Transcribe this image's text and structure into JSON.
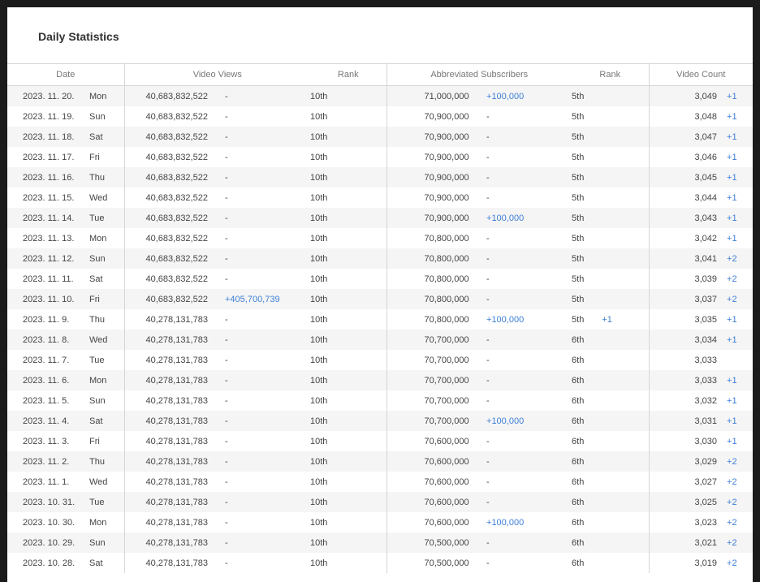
{
  "page": {
    "title": "Daily Statistics"
  },
  "columns": {
    "date": "Date",
    "video_views": "Video Views",
    "rank": "Rank",
    "subscribers": "Abbreviated Subscribers",
    "sub_rank": "Rank",
    "video_count": "Video Count"
  },
  "accent_color": "#3d7fd6",
  "rows": [
    {
      "date": "2023. 11. 20.",
      "day": "Mon",
      "views": "40,683,832,522",
      "views_change": "-",
      "rank": "10th",
      "subs": "71,000,000",
      "subs_change": "+100,000",
      "sub_rank": "5th",
      "sub_rank_change": "",
      "video_count": "3,049",
      "video_count_change": "+1"
    },
    {
      "date": "2023. 11. 19.",
      "day": "Sun",
      "views": "40,683,832,522",
      "views_change": "-",
      "rank": "10th",
      "subs": "70,900,000",
      "subs_change": "-",
      "sub_rank": "5th",
      "sub_rank_change": "",
      "video_count": "3,048",
      "video_count_change": "+1"
    },
    {
      "date": "2023. 11. 18.",
      "day": "Sat",
      "views": "40,683,832,522",
      "views_change": "-",
      "rank": "10th",
      "subs": "70,900,000",
      "subs_change": "-",
      "sub_rank": "5th",
      "sub_rank_change": "",
      "video_count": "3,047",
      "video_count_change": "+1"
    },
    {
      "date": "2023. 11. 17.",
      "day": "Fri",
      "views": "40,683,832,522",
      "views_change": "-",
      "rank": "10th",
      "subs": "70,900,000",
      "subs_change": "-",
      "sub_rank": "5th",
      "sub_rank_change": "",
      "video_count": "3,046",
      "video_count_change": "+1"
    },
    {
      "date": "2023. 11. 16.",
      "day": "Thu",
      "views": "40,683,832,522",
      "views_change": "-",
      "rank": "10th",
      "subs": "70,900,000",
      "subs_change": "-",
      "sub_rank": "5th",
      "sub_rank_change": "",
      "video_count": "3,045",
      "video_count_change": "+1"
    },
    {
      "date": "2023. 11. 15.",
      "day": "Wed",
      "views": "40,683,832,522",
      "views_change": "-",
      "rank": "10th",
      "subs": "70,900,000",
      "subs_change": "-",
      "sub_rank": "5th",
      "sub_rank_change": "",
      "video_count": "3,044",
      "video_count_change": "+1"
    },
    {
      "date": "2023. 11. 14.",
      "day": "Tue",
      "views": "40,683,832,522",
      "views_change": "-",
      "rank": "10th",
      "subs": "70,900,000",
      "subs_change": "+100,000",
      "sub_rank": "5th",
      "sub_rank_change": "",
      "video_count": "3,043",
      "video_count_change": "+1"
    },
    {
      "date": "2023. 11. 13.",
      "day": "Mon",
      "views": "40,683,832,522",
      "views_change": "-",
      "rank": "10th",
      "subs": "70,800,000",
      "subs_change": "-",
      "sub_rank": "5th",
      "sub_rank_change": "",
      "video_count": "3,042",
      "video_count_change": "+1"
    },
    {
      "date": "2023. 11. 12.",
      "day": "Sun",
      "views": "40,683,832,522",
      "views_change": "-",
      "rank": "10th",
      "subs": "70,800,000",
      "subs_change": "-",
      "sub_rank": "5th",
      "sub_rank_change": "",
      "video_count": "3,041",
      "video_count_change": "+2"
    },
    {
      "date": "2023. 11. 11.",
      "day": "Sat",
      "views": "40,683,832,522",
      "views_change": "-",
      "rank": "10th",
      "subs": "70,800,000",
      "subs_change": "-",
      "sub_rank": "5th",
      "sub_rank_change": "",
      "video_count": "3,039",
      "video_count_change": "+2"
    },
    {
      "date": "2023. 11. 10.",
      "day": "Fri",
      "views": "40,683,832,522",
      "views_change": "+405,700,739",
      "rank": "10th",
      "subs": "70,800,000",
      "subs_change": "-",
      "sub_rank": "5th",
      "sub_rank_change": "",
      "video_count": "3,037",
      "video_count_change": "+2"
    },
    {
      "date": "2023. 11. 9.",
      "day": "Thu",
      "views": "40,278,131,783",
      "views_change": "-",
      "rank": "10th",
      "subs": "70,800,000",
      "subs_change": "+100,000",
      "sub_rank": "5th",
      "sub_rank_change": "+1",
      "video_count": "3,035",
      "video_count_change": "+1"
    },
    {
      "date": "2023. 11. 8.",
      "day": "Wed",
      "views": "40,278,131,783",
      "views_change": "-",
      "rank": "10th",
      "subs": "70,700,000",
      "subs_change": "-",
      "sub_rank": "6th",
      "sub_rank_change": "",
      "video_count": "3,034",
      "video_count_change": "+1"
    },
    {
      "date": "2023. 11. 7.",
      "day": "Tue",
      "views": "40,278,131,783",
      "views_change": "-",
      "rank": "10th",
      "subs": "70,700,000",
      "subs_change": "-",
      "sub_rank": "6th",
      "sub_rank_change": "",
      "video_count": "3,033",
      "video_count_change": ""
    },
    {
      "date": "2023. 11. 6.",
      "day": "Mon",
      "views": "40,278,131,783",
      "views_change": "-",
      "rank": "10th",
      "subs": "70,700,000",
      "subs_change": "-",
      "sub_rank": "6th",
      "sub_rank_change": "",
      "video_count": "3,033",
      "video_count_change": "+1"
    },
    {
      "date": "2023. 11. 5.",
      "day": "Sun",
      "views": "40,278,131,783",
      "views_change": "-",
      "rank": "10th",
      "subs": "70,700,000",
      "subs_change": "-",
      "sub_rank": "6th",
      "sub_rank_change": "",
      "video_count": "3,032",
      "video_count_change": "+1"
    },
    {
      "date": "2023. 11. 4.",
      "day": "Sat",
      "views": "40,278,131,783",
      "views_change": "-",
      "rank": "10th",
      "subs": "70,700,000",
      "subs_change": "+100,000",
      "sub_rank": "6th",
      "sub_rank_change": "",
      "video_count": "3,031",
      "video_count_change": "+1"
    },
    {
      "date": "2023. 11. 3.",
      "day": "Fri",
      "views": "40,278,131,783",
      "views_change": "-",
      "rank": "10th",
      "subs": "70,600,000",
      "subs_change": "-",
      "sub_rank": "6th",
      "sub_rank_change": "",
      "video_count": "3,030",
      "video_count_change": "+1"
    },
    {
      "date": "2023. 11. 2.",
      "day": "Thu",
      "views": "40,278,131,783",
      "views_change": "-",
      "rank": "10th",
      "subs": "70,600,000",
      "subs_change": "-",
      "sub_rank": "6th",
      "sub_rank_change": "",
      "video_count": "3,029",
      "video_count_change": "+2"
    },
    {
      "date": "2023. 11. 1.",
      "day": "Wed",
      "views": "40,278,131,783",
      "views_change": "-",
      "rank": "10th",
      "subs": "70,600,000",
      "subs_change": "-",
      "sub_rank": "6th",
      "sub_rank_change": "",
      "video_count": "3,027",
      "video_count_change": "+2"
    },
    {
      "date": "2023. 10. 31.",
      "day": "Tue",
      "views": "40,278,131,783",
      "views_change": "-",
      "rank": "10th",
      "subs": "70,600,000",
      "subs_change": "-",
      "sub_rank": "6th",
      "sub_rank_change": "",
      "video_count": "3,025",
      "video_count_change": "+2"
    },
    {
      "date": "2023. 10. 30.",
      "day": "Mon",
      "views": "40,278,131,783",
      "views_change": "-",
      "rank": "10th",
      "subs": "70,600,000",
      "subs_change": "+100,000",
      "sub_rank": "6th",
      "sub_rank_change": "",
      "video_count": "3,023",
      "video_count_change": "+2"
    },
    {
      "date": "2023. 10. 29.",
      "day": "Sun",
      "views": "40,278,131,783",
      "views_change": "-",
      "rank": "10th",
      "subs": "70,500,000",
      "subs_change": "-",
      "sub_rank": "6th",
      "sub_rank_change": "",
      "video_count": "3,021",
      "video_count_change": "+2"
    },
    {
      "date": "2023. 10. 28.",
      "day": "Sat",
      "views": "40,278,131,783",
      "views_change": "-",
      "rank": "10th",
      "subs": "70,500,000",
      "subs_change": "-",
      "sub_rank": "6th",
      "sub_rank_change": "",
      "video_count": "3,019",
      "video_count_change": "+2"
    }
  ]
}
